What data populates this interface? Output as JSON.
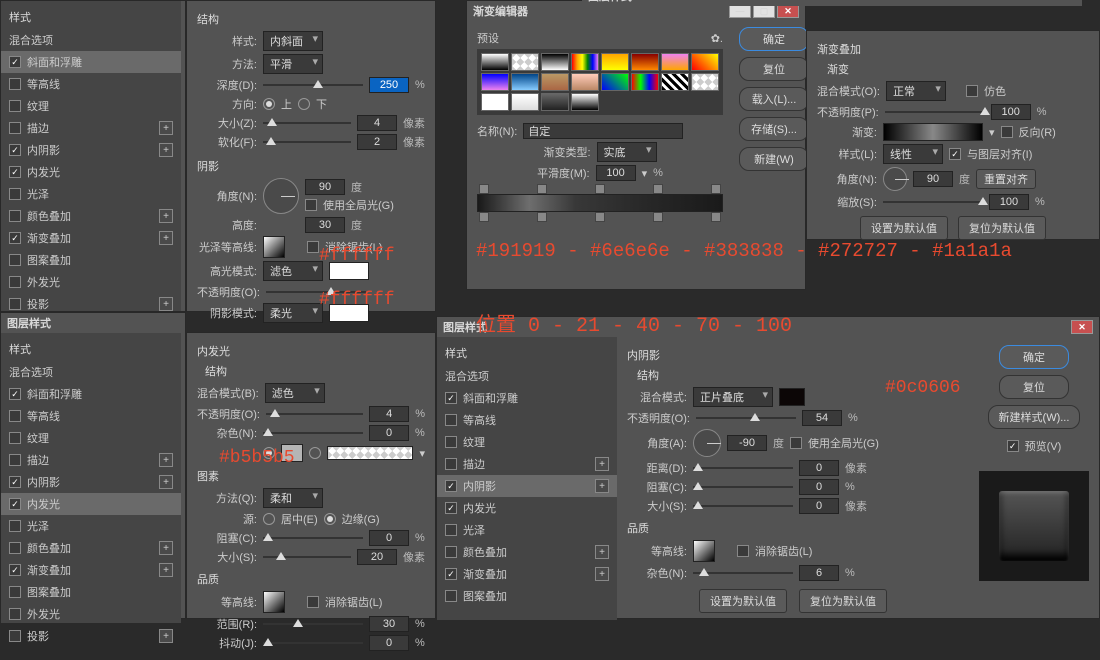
{
  "titles": {
    "layer_style": "图层样式",
    "gradient_editor": "渐变编辑器"
  },
  "styles_panel": {
    "header": "样式",
    "blend_options": "混合选项",
    "items": [
      "斜面和浮雕",
      "等高线",
      "纹理",
      "描边",
      "内阴影",
      "内发光",
      "光泽",
      "颜色叠加",
      "渐变叠加",
      "图案叠加",
      "外发光",
      "投影"
    ]
  },
  "bevel": {
    "section": "结构",
    "style_label": "样式:",
    "style_value": "内斜面",
    "method_label": "方法:",
    "method_value": "平滑",
    "depth_label": "深度(D):",
    "depth_value": "250",
    "direction_label": "方向:",
    "up": "上",
    "down": "下",
    "size_label": "大小(Z):",
    "size_value": "4",
    "soften_label": "软化(F):",
    "soften_value": "2",
    "pixels": "像素",
    "percent": "%",
    "shadow_section": "阴影",
    "angle_label": "角度(N):",
    "angle_value": "90",
    "degree": "度",
    "global_light": "使用全局光(G)",
    "altitude_label": "高度:",
    "altitude_value": "30",
    "gloss_label": "光泽等高线:",
    "antialias": "消除锯齿(L)",
    "highlight_mode_label": "高光模式:",
    "highlight_mode_value": "滤色",
    "shadow_mode_label": "阴影模式:",
    "shadow_mode_value": "柔光",
    "opacity_label": "不透明度(O):"
  },
  "gradient_editor": {
    "presets": "预设",
    "ok": "确定",
    "cancel": "复位",
    "load": "载入(L)...",
    "save": "存储(S)...",
    "new": "新建(W)",
    "name_label": "名称(N):",
    "name_value": "自定",
    "type_label": "渐变类型:",
    "type_value": "实底",
    "smoothness_label": "平滑度(M):",
    "smoothness_value": "100"
  },
  "grad_overlay": {
    "section1": "渐变叠加",
    "section2": "渐变",
    "blend_label": "混合模式(O):",
    "blend_value": "正常",
    "dither": "仿色",
    "opacity_label": "不透明度(P):",
    "opacity_value": "100",
    "gradient_label": "渐变:",
    "reverse": "反向(R)",
    "style_label": "样式(L):",
    "style_value": "线性",
    "align": "与图层对齐(I)",
    "angle_label": "角度(N):",
    "angle_value": "90",
    "degree": "度",
    "reset_align": "重置对齐",
    "scale_label": "缩放(S):",
    "scale_value": "100",
    "default_btn": "设置为默认值",
    "reset_btn": "复位为默认值"
  },
  "inner_glow": {
    "title": "内发光",
    "structure": "结构",
    "blend_label": "混合模式(B):",
    "blend_value": "滤色",
    "opacity_label": "不透明度(O):",
    "opacity_value": "4",
    "noise_label": "杂色(N):",
    "noise_value": "0",
    "element": "图素",
    "method_label": "方法(Q):",
    "method_value": "柔和",
    "source_center": "居中(E)",
    "source_edge": "边缘(G)",
    "choke_label": "阻塞(C):",
    "choke_value": "0",
    "size_label": "大小(S):",
    "size_value": "20",
    "quality": "品质",
    "contour_label": "等高线:",
    "antialias": "消除锯齿(L)",
    "range_label": "范围(R):",
    "range_value": "30",
    "jitter_label": "抖动(J):",
    "jitter_value": "0"
  },
  "inner_shadow": {
    "title": "内阴影",
    "structure": "结构",
    "blend_label": "混合模式:",
    "blend_value": "正片叠底",
    "opacity_label": "不透明度(O):",
    "opacity_value": "54",
    "angle_label": "角度(A):",
    "angle_value": "-90",
    "degree": "度",
    "global_light": "使用全局光(G)",
    "distance_label": "距离(D):",
    "distance_value": "0",
    "choke_label": "阻塞(C):",
    "choke_value": "0",
    "size_label": "大小(S):",
    "size_value": "0",
    "pixels": "像素",
    "quality": "品质",
    "contour_label": "等高线:",
    "antialias": "消除锯齿(L)",
    "noise_label": "杂色(N):",
    "noise_value": "6",
    "default_btn": "设置为默认值",
    "reset_btn": "复位为默认值",
    "ok": "确定",
    "cancel": "复位",
    "new_style": "新建样式(W)...",
    "preview": "预览(V)"
  },
  "annotations": {
    "white1": "#ffffff",
    "white2": "#ffffff",
    "grad_colors": "#191919 - #6e6e6e - #383838 - #272727 - #1a1a1a",
    "positions": "位置 0 - 21 - 40 - 70 - 100",
    "b5": "#b5b5b5",
    "dark": "#0c0606"
  }
}
